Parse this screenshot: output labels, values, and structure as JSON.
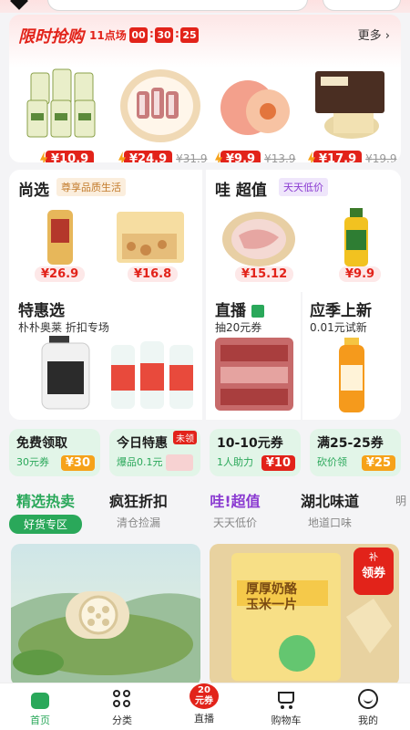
{
  "flash_sale": {
    "title": "限时抢购",
    "session": "11点场",
    "countdown": [
      "00",
      "30",
      "25"
    ],
    "more": "更多",
    "items": [
      {
        "name": "bottled-oil",
        "price": "¥10.9",
        "old_price": ""
      },
      {
        "name": "pork-ribs",
        "price": "¥24.9",
        "old_price": "¥31.9"
      },
      {
        "name": "peach",
        "price": "¥9.9",
        "old_price": "¥13.9"
      },
      {
        "name": "noodles-box",
        "price": "¥17.9",
        "old_price": "¥19.9"
      }
    ]
  },
  "shangxuan": {
    "title": "尚选",
    "tag": "尊享品质生活",
    "items": [
      {
        "price": "¥26.9"
      },
      {
        "price": "¥16.8"
      }
    ]
  },
  "wachaozhi": {
    "title": "哇",
    "title2": "超值",
    "tag": "天天低价",
    "items": [
      {
        "price": "¥15.12"
      },
      {
        "price": "¥9.9"
      }
    ]
  },
  "tehuixuan": {
    "title": "特惠选",
    "sub": "朴朴奥莱 折扣专场"
  },
  "zhibo": {
    "title": "直播",
    "sub": "抽20元券"
  },
  "yingji": {
    "title": "应季上新",
    "sub": "0.01元试新"
  },
  "chips": [
    {
      "title": "免费领取",
      "sub": "30元券",
      "value": "¥30"
    },
    {
      "title": "今日特惠",
      "sub": "爆品0.1元",
      "badge": "未领"
    },
    {
      "title": "10-10元券",
      "sub": "1人助力",
      "value": "¥10"
    },
    {
      "title": "满25-25券",
      "sub": "砍价领",
      "value": "¥25"
    }
  ],
  "tabs": [
    {
      "label": "精选热卖",
      "sub": "好货专区"
    },
    {
      "label": "疯狂折扣",
      "sub": "清仓捡漏"
    },
    {
      "label": "哇!超值",
      "sub": "天天低价"
    },
    {
      "label": "湖北味道",
      "sub": "地道口味"
    },
    {
      "label": "",
      "sub": "明"
    }
  ],
  "feed": [
    {
      "badge": ""
    },
    {
      "badge": "领券",
      "badge_top": "补",
      "pack_text": "厚厚奶酪\n玉米一片"
    }
  ],
  "bottom_nav": [
    {
      "label": "首页"
    },
    {
      "label": "分类"
    },
    {
      "label": "直播",
      "badge": "20\n元券"
    },
    {
      "label": "购物车"
    },
    {
      "label": "我的"
    }
  ],
  "colors": {
    "accent_red": "#e2231a",
    "accent_green": "#2aa85a",
    "gold": "#f6a21a"
  }
}
